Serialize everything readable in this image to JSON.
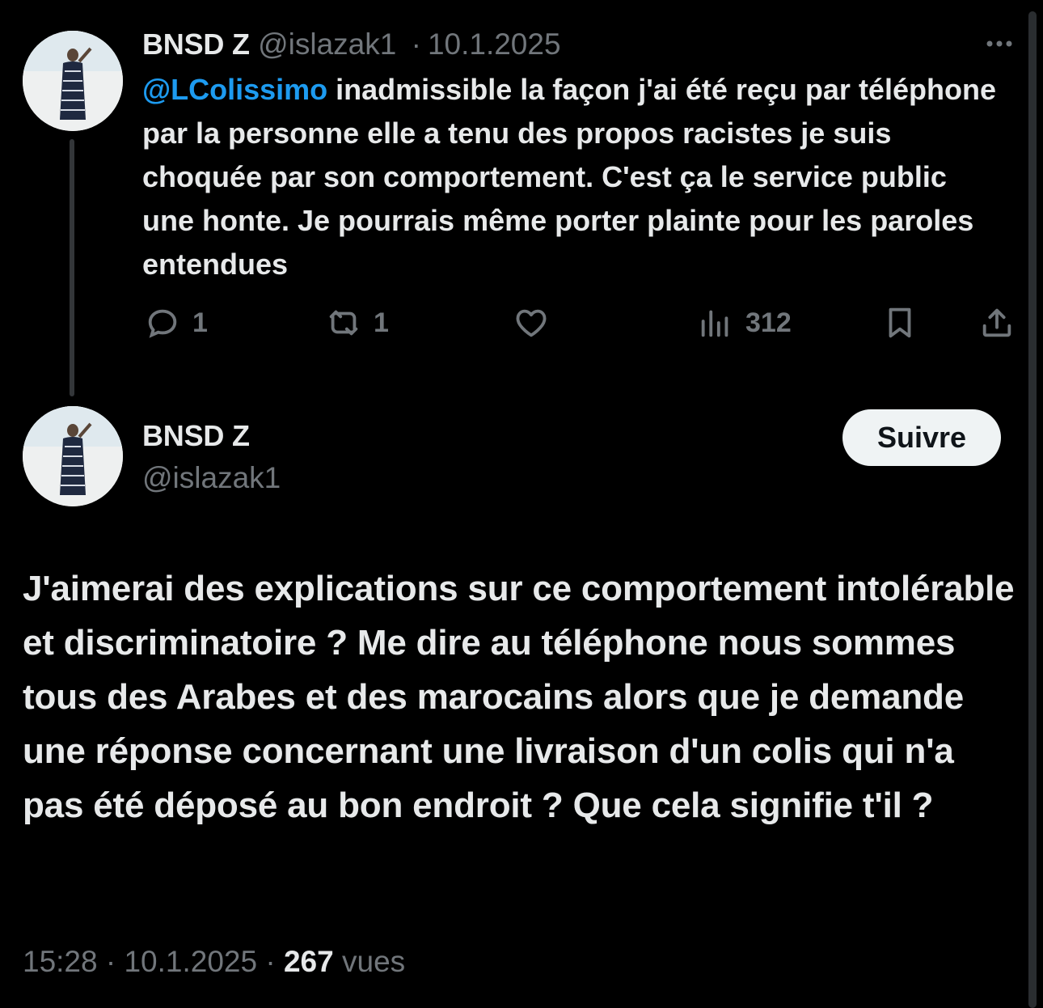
{
  "first_tweet": {
    "display_name": "BNSD Z",
    "handle": "@islazak1",
    "separator": "·",
    "date": "10.1.2025",
    "mention": "@LColissimo",
    "text": " inadmissible la façon j'ai été reçu par téléphone par la personne elle a tenu des propos racistes je suis choquée par son comportement. C'est ça le service public une honte. Je pourrais même porter plainte pour les paroles entendues",
    "actions": {
      "reply_count": "1",
      "repost_count": "1",
      "like_count": "",
      "views_count": "312"
    }
  },
  "main_tweet": {
    "display_name": "BNSD Z",
    "handle": "@islazak1",
    "follow_label": "Suivre",
    "text": "J'aimerai des explications sur ce comportement intolérable et discriminatoire ? Me dire au téléphone nous sommes tous des Arabes et des marocains alors que je demande une réponse concernant une livraison d'un colis qui n'a pas été déposé au bon endroit ? Que cela signifie t'il ?",
    "time": "15:28",
    "separator": "·",
    "date": "10.1.2025",
    "views_count": "267",
    "views_label": "vues"
  },
  "colors": {
    "background": "#000000",
    "text": "#e7e9ea",
    "muted": "#71767b",
    "mention": "#1d9bf0",
    "follow_bg": "#eff3f4"
  },
  "icons": [
    "avatar",
    "more-icon",
    "reply-icon",
    "repost-icon",
    "like-icon",
    "views-icon",
    "bookmark-icon",
    "share-icon"
  ]
}
